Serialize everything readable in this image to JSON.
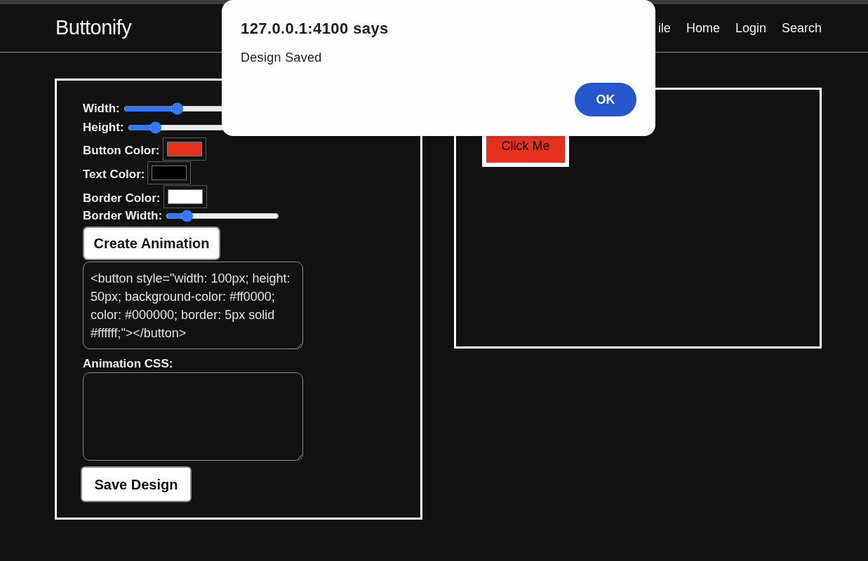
{
  "header": {
    "logo": "Buttonify",
    "nav": [
      {
        "label": "ile"
      },
      {
        "label": "Home"
      },
      {
        "label": "Login"
      },
      {
        "label": "Search"
      }
    ]
  },
  "editor": {
    "controls": [
      {
        "kind": "slider",
        "label": "Width:",
        "level": 0.47
      },
      {
        "kind": "slider",
        "label": "Height:",
        "level": 0.21
      },
      {
        "kind": "color",
        "label": "Button Color:",
        "color": "#e8321f"
      },
      {
        "kind": "color",
        "label": "Text Color:",
        "color": "#000000"
      },
      {
        "kind": "color",
        "label": "Border Color:",
        "color": "#ffffff"
      },
      {
        "kind": "slider",
        "label": "Border Width:",
        "level": 0.14
      }
    ],
    "create_button": "Create Animation",
    "code_output": {
      "value": "<button style=\"width: 100px; height: 50px; background-color: #ff0000; color: #000000; border: 5px solid #ffffff;\"></button>"
    },
    "animation_css": {
      "label": "Animation CSS:"
    },
    "save_button": "Save Design"
  },
  "preview": {
    "button_label": "Click Me"
  },
  "dialog": {
    "title": "127.0.0.1:4100 says",
    "message": "Design Saved",
    "button": "OK"
  }
}
